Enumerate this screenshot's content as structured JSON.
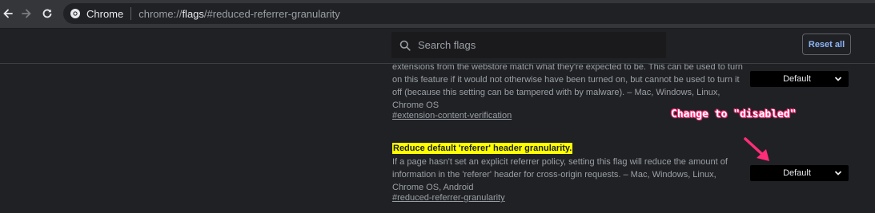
{
  "browser": {
    "site_name": "Chrome",
    "url_scheme": "chrome://",
    "url_host": "flags",
    "url_path": "/#reduced-referrer-granularity"
  },
  "header": {
    "search_placeholder": "Search flags",
    "reset_label": "Reset all"
  },
  "flags": [
    {
      "description": "extensions from the webstore match what they're expected to be. This can be used to turn on this feature if it would not otherwise have been turned on, but cannot be used to turn it off (because this setting can be tampered with by malware). – Mac, Windows, Linux, Chrome OS",
      "link": "#extension-content-verification",
      "select_value": "Default"
    },
    {
      "title": "Reduce default 'referer' header granularity.",
      "description": "If a page hasn't set an explicit referrer policy, setting this flag will reduce the amount of information in the 'referer' header for cross-origin requests. – Mac, Windows, Linux, Chrome OS, Android",
      "link": "#reduced-referrer-granularity",
      "select_value": "Default"
    }
  ],
  "annotation": {
    "text": "Change to \"disabled\"",
    "color": "#ff2d79"
  },
  "colors": {
    "highlight": "#ffff00",
    "accent": "#8ab4f8"
  }
}
